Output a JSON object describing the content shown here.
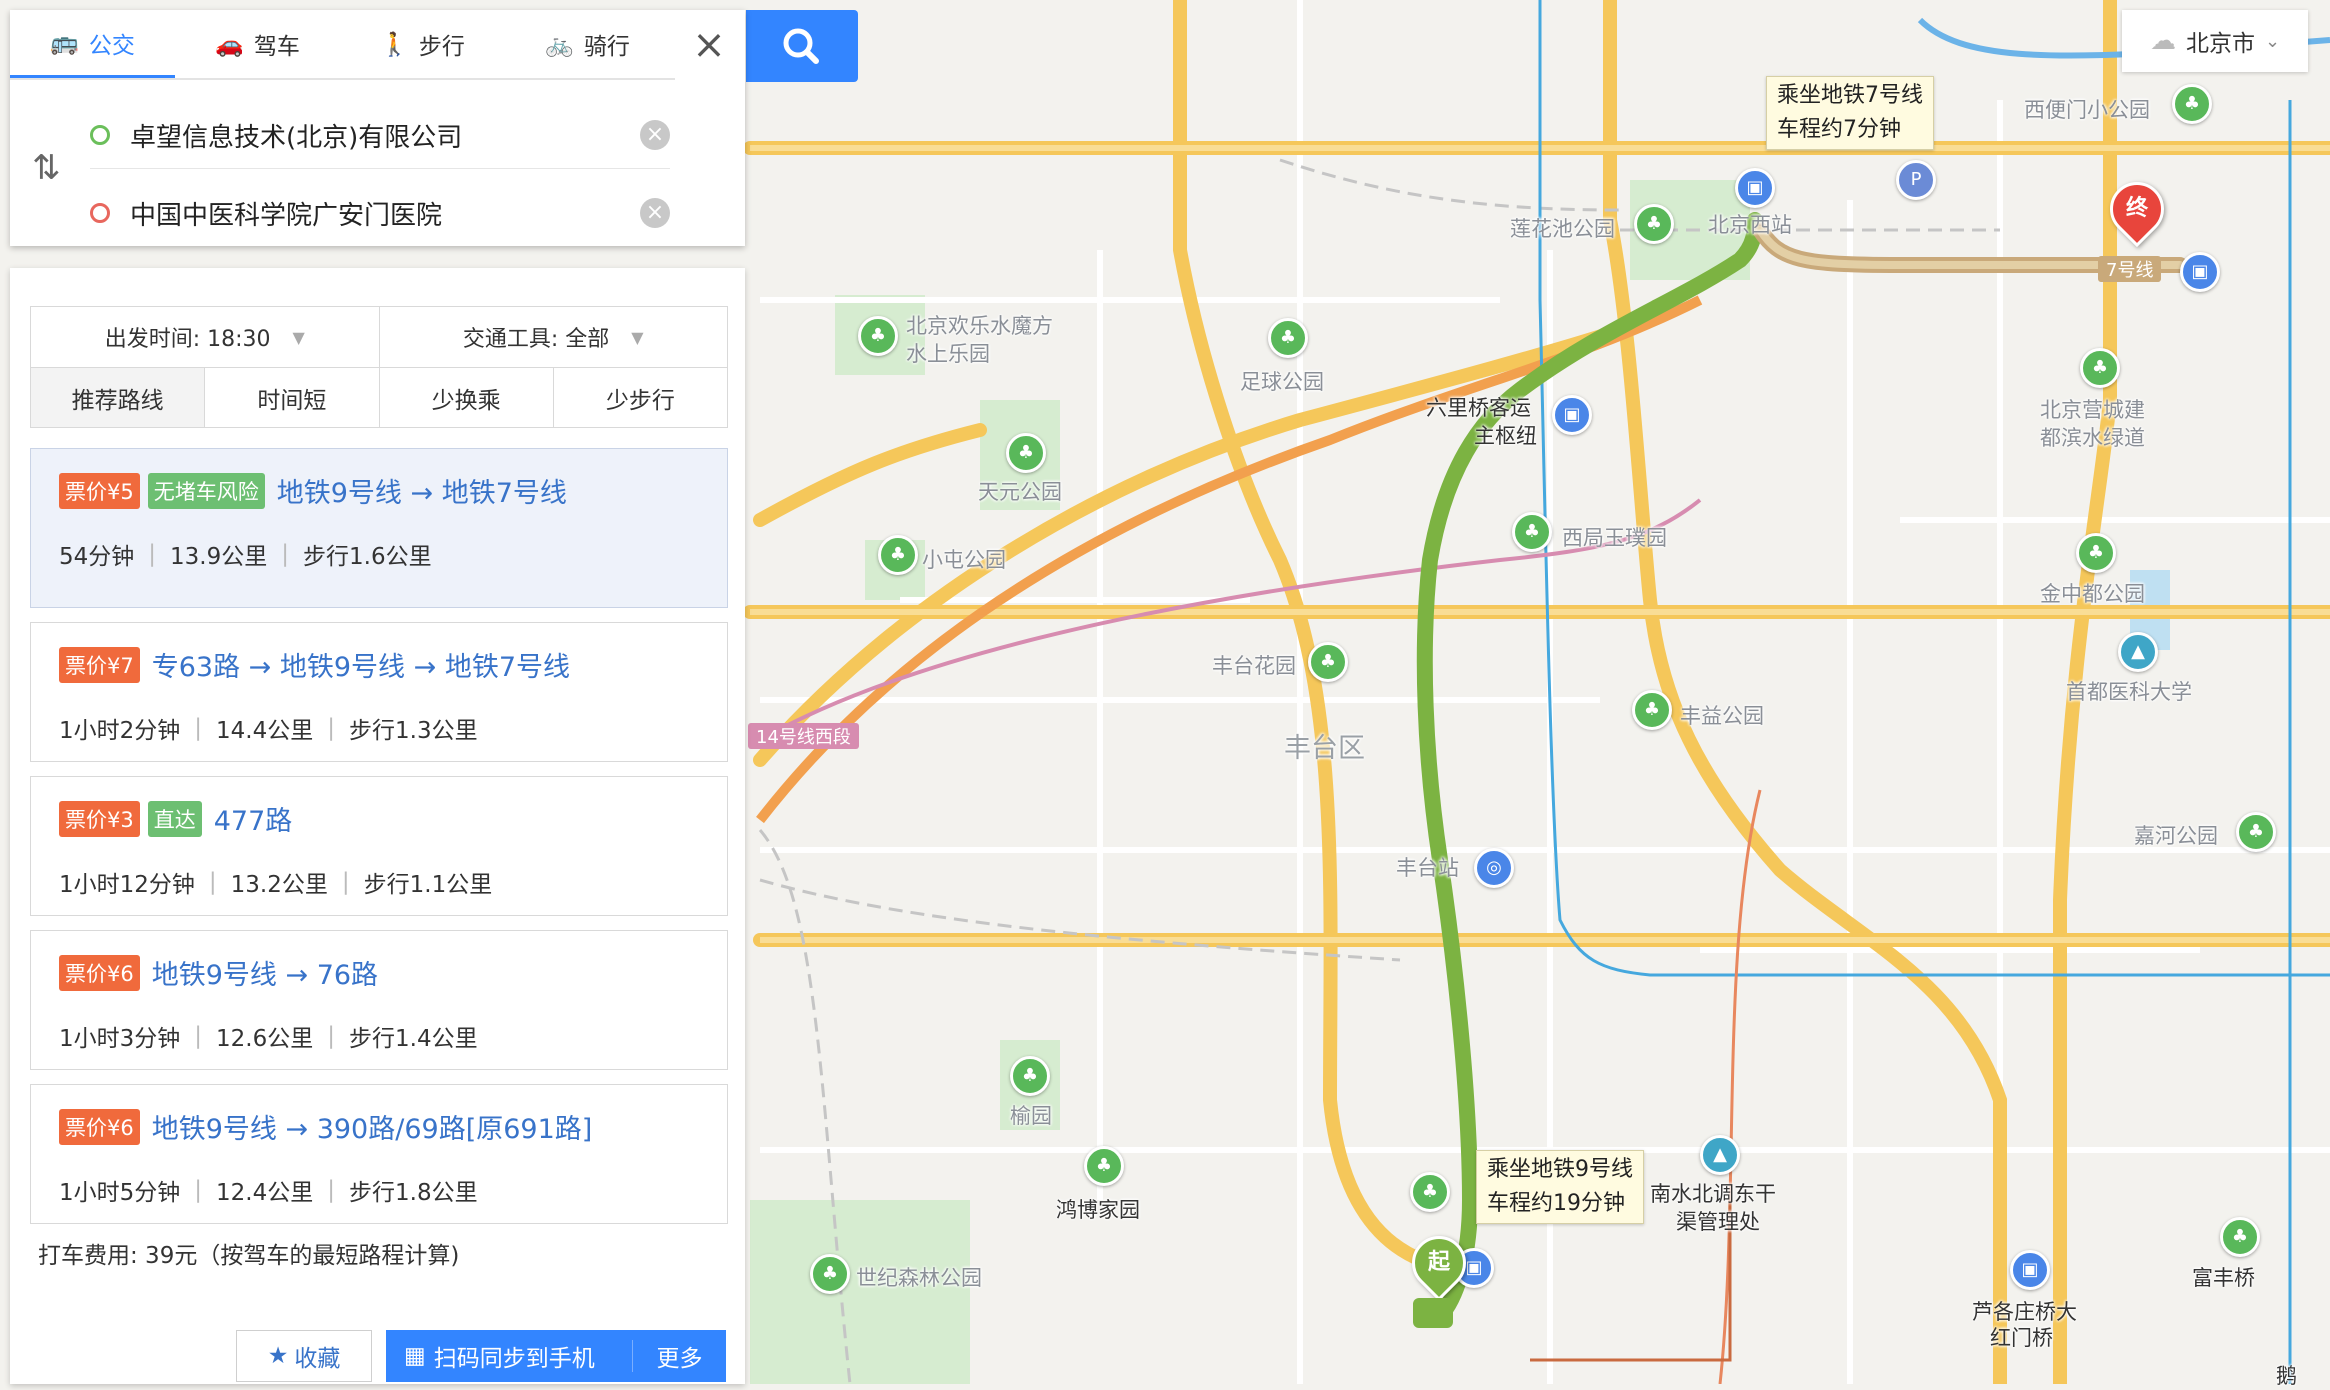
{
  "modes": [
    {
      "label": "公交",
      "icon": "bus-icon",
      "active": true
    },
    {
      "label": "驾车",
      "icon": "car-icon",
      "active": false
    },
    {
      "label": "步行",
      "icon": "walk-icon",
      "active": false
    },
    {
      "label": "骑行",
      "icon": "bike-icon",
      "active": false
    }
  ],
  "origin": {
    "value": "卓望信息技术(北京)有限公司"
  },
  "destination": {
    "value": "中国中医科学院广安门医院"
  },
  "filters": {
    "depart_label": "出发时间: 18:30",
    "transport_label": "交通工具: 全部",
    "sorts": [
      "推荐路线",
      "时间短",
      "少换乘",
      "少步行"
    ]
  },
  "routes": [
    {
      "price": "票价¥5",
      "tag": "无堵车风险",
      "title": "地铁9号线 → 地铁7号线",
      "duration": "54分钟",
      "distance": "13.9公里",
      "walk": "步行1.6公里"
    },
    {
      "price": "票价¥7",
      "tag": "",
      "title": "专63路 → 地铁9号线 → 地铁7号线",
      "duration": "1小时2分钟",
      "distance": "14.4公里",
      "walk": "步行1.3公里"
    },
    {
      "price": "票价¥3",
      "tag": "直达",
      "title": "477路",
      "duration": "1小时12分钟",
      "distance": "13.2公里",
      "walk": "步行1.1公里"
    },
    {
      "price": "票价¥6",
      "tag": "",
      "title": "地铁9号线 → 76路",
      "duration": "1小时3分钟",
      "distance": "12.6公里",
      "walk": "步行1.4公里"
    },
    {
      "price": "票价¥6",
      "tag": "",
      "title": "地铁9号线 → 390路/69路[原691路]",
      "duration": "1小时5分钟",
      "distance": "12.4公里",
      "walk": "步行1.8公里"
    }
  ],
  "taxi": "打车费用: 39元（按驾车的最短路程计算)",
  "actions": {
    "favorite": "收藏",
    "scan": "扫码同步到手机",
    "more": "更多"
  },
  "city": "北京市",
  "map": {
    "tip_line7": [
      "乘坐地铁7号线",
      "车程约7分钟"
    ],
    "tip_line9": [
      "乘坐地铁9号线",
      "车程约19分钟"
    ],
    "start_marker": "起",
    "end_marker": "终",
    "line7_label": "7号线",
    "line14_label": "14号线西段",
    "labels": {
      "xibianmen": "西便门小公园",
      "lianhuachi": "莲花池公园",
      "beijingxi": "北京西站",
      "huanle": "北京欢乐水魔方",
      "huanle2": "水上乐园",
      "zuqiu": "足球公园",
      "liuliqiao": "六里桥客运",
      "liuliqiao2": "主枢纽",
      "tianyuan": "天元公园",
      "xiju": "西局玉璞园",
      "xiaotun": "小屯公园",
      "yingcheng": "北京营城建",
      "yingcheng2": "都滨水绿道",
      "jinzhongdu": "金中都公园",
      "fengtaihua": "丰台花园",
      "fengtaiqu": "丰台区",
      "fengyi": "丰益公园",
      "shouyi": "首都医科大学",
      "jiahe": "嘉河公园",
      "fengtaizhan": "丰台站",
      "yuyuan": "榆园",
      "hongbo": "鸿博家园",
      "nanshui": "南水北调东干",
      "nanshui2": "渠管理处",
      "shiji": "世纪森林公园",
      "lugezhuang": "芦各庄桥大",
      "lugezhuang2": "红门桥",
      "fufeng": "富丰桥",
      "echang": "鹅"
    }
  },
  "colors": {
    "accent": "#3385ff",
    "route_green": "#7cb342",
    "price_tag": "#f06a3c",
    "green_tag": "#6dbf72",
    "link": "#3873c9"
  }
}
